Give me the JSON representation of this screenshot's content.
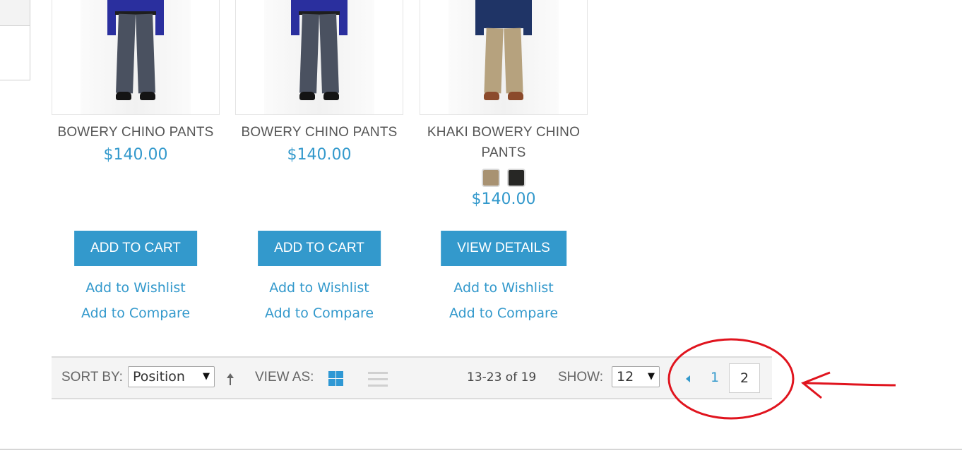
{
  "products": [
    {
      "name": "BOWERY CHINO PANTS",
      "price": "$140.00",
      "button_label": "ADD TO CART",
      "wishlist_label": "Add to Wishlist",
      "compare_label": "Add to Compare",
      "colors": {
        "shirt": "#2a2f9e",
        "pants": "#4a5160",
        "shoes": "#141414"
      },
      "swatches": []
    },
    {
      "name": "BOWERY CHINO PANTS",
      "price": "$140.00",
      "button_label": "ADD TO CART",
      "wishlist_label": "Add to Wishlist",
      "compare_label": "Add to Compare",
      "colors": {
        "shirt": "#2a2f9e",
        "pants": "#4a5160",
        "shoes": "#141414"
      },
      "swatches": []
    },
    {
      "name": "KHAKI BOWERY CHINO PANTS",
      "price": "$140.00",
      "button_label": "VIEW DETAILS",
      "wishlist_label": "Add to Wishlist",
      "compare_label": "Add to Compare",
      "colors": {
        "shirt": "#1f3466",
        "pants": "#b6a27e",
        "shoes": "#8b4a2b"
      },
      "swatches": [
        {
          "name": "khaki",
          "color": "#a89272"
        },
        {
          "name": "black",
          "color": "#272725"
        }
      ]
    }
  ],
  "toolbar": {
    "sort_label": "SORT BY:",
    "sort_value": "Position",
    "sort_caret": "▼",
    "view_label": "VIEW AS:",
    "count_text": "13-23 of 19",
    "show_label": "SHOW:",
    "show_value": "12",
    "show_caret": "▼",
    "pages": [
      "1",
      "2"
    ],
    "current_page": "2"
  },
  "theme": {
    "accent": "#3399cc",
    "annotation": "#e0141e"
  }
}
